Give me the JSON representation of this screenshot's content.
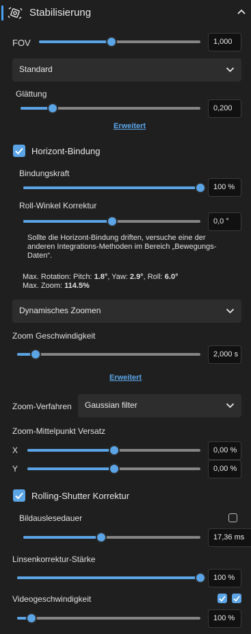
{
  "header": {
    "title": "Stabilisierung",
    "icon": "stabilize-icon"
  },
  "accent_color": "#5ba4e6",
  "fov": {
    "label": "FOV",
    "value": "1,000",
    "fraction": 0.45
  },
  "smoothing_method": {
    "selected": "Standard"
  },
  "smoothness": {
    "label": "Glättung",
    "value": "0,200",
    "fraction": 0.18
  },
  "advanced_link_1": "Erweitert",
  "horizon_lock": {
    "label": "Horizont-Bindung",
    "checked": true,
    "strength": {
      "label": "Bindungskraft",
      "value": "100 %",
      "fraction": 1.0
    },
    "roll": {
      "label": "Roll-Winkel Korrektur",
      "value": "0,0 °",
      "fraction": 0.5
    },
    "info_line1": "Sollte die Horizont-Bindung driften, versuche eine der",
    "info_line2": "anderen Integrations-Methoden im Bereich „Bewegungs-",
    "info_line3": "Daten“.",
    "max_rotation_prefix": "Max. Rotation: Pitch:",
    "pitch": "1.8°",
    "yaw_prefix": ", Yaw:",
    "yaw": "2.9°",
    "roll_prefix": ", Roll:",
    "roll_max": "6.0°",
    "max_zoom_prefix": "Max. Zoom:",
    "max_zoom": "114.5%"
  },
  "dynamic_zoom": {
    "selected": "Dynamisches Zoomen"
  },
  "zoom_speed": {
    "label": "Zoom Geschwindigkeit",
    "value": "2,000 s",
    "fraction": 0.1
  },
  "advanced_link_2": "Erweitert",
  "zoom_method": {
    "label": "Zoom-Verfahren",
    "selected": "Gaussian filter"
  },
  "zoom_offset": {
    "label": "Zoom-Mittelpunkt Versatz",
    "x": {
      "label": "X",
      "value": "0,00 %",
      "fraction": 0.5
    },
    "y": {
      "label": "Y",
      "value": "0,00 %",
      "fraction": 0.5
    }
  },
  "rolling_shutter": {
    "label": "Rolling-Shutter Korrektur",
    "checked": true,
    "readout_label": "Bildauslesedauer",
    "readout_checked": false,
    "value": "17,36 ms",
    "fraction": 0.44
  },
  "lens_correction": {
    "label": "Linsenkorrektur-Stärke",
    "value": "100 %",
    "fraction": 1.0
  },
  "video_speed": {
    "label": "Videogeschwindigkeit",
    "value": "100 %",
    "fraction": 0.08,
    "check1": true,
    "check2": true
  }
}
